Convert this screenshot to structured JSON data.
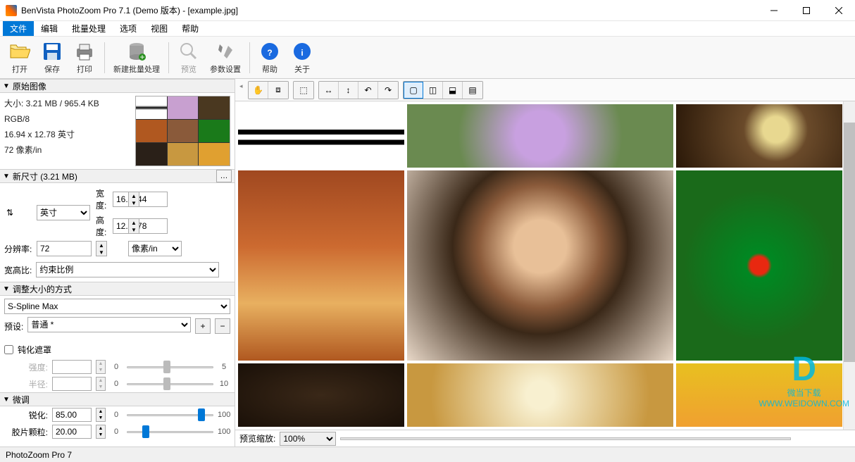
{
  "app": {
    "title": "BenVista PhotoZoom Pro 7.1 (Demo 版本) - [example.jpg]"
  },
  "menu": {
    "file": "文件",
    "edit": "编辑",
    "batch": "批量处理",
    "options": "选项",
    "view": "视图",
    "help": "帮助"
  },
  "toolbar": {
    "open": "打开",
    "save": "保存",
    "print": "打印",
    "newbatch": "新建批量处理",
    "preview": "预览",
    "params": "参数设置",
    "help": "帮助",
    "about": "关于"
  },
  "sections": {
    "original": "原始图像",
    "newsize": "新尺寸 (3.21 MB)",
    "resize": "调整大小的方式",
    "finetune": "微调"
  },
  "original": {
    "size": "大小: 3.21 MB / 965.4 KB",
    "mode": "RGB/8",
    "dims": "16.94 x 12.78 英寸",
    "res": "72 像素/in"
  },
  "newsize": {
    "width_lbl": "宽度:",
    "width_val": "16.9444",
    "height_lbl": "高度:",
    "height_val": "12.7778",
    "res_lbl": "分辨率:",
    "res_val": "72",
    "unit_dim": "英寸",
    "unit_res": "像素/in",
    "aspect_lbl": "宽高比:",
    "aspect_val": "约束比例"
  },
  "resize": {
    "algo": "S-Spline Max",
    "preset_lbl": "预设:",
    "preset_val": "普通 *",
    "unsharp": "钝化遮罩",
    "intensity": "强度:",
    "intensity_val": "",
    "intensity_min": "0",
    "intensity_max": "5",
    "radius": "半径:",
    "radius_val": "",
    "radius_min": "0",
    "radius_max": "10",
    "sharp": "锐化:",
    "sharp_val": "85.00",
    "sharp_min": "0",
    "sharp_max": "100",
    "grain": "胶片颗粒:",
    "grain_val": "20.00",
    "grain_min": "0",
    "grain_max": "100"
  },
  "previewbar": {
    "zoom_lbl": "预览缩放:",
    "zoom_val": "100%"
  },
  "status": {
    "text": "PhotoZoom Pro 7"
  },
  "watermark": {
    "site": "WWW.WEIDOWN.COM",
    "brand": "微当下载"
  }
}
